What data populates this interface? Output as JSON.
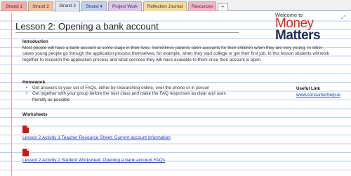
{
  "tabs": [
    {
      "label": "Strand 1",
      "color": "#f6a9a9"
    },
    {
      "label": "Strand 2",
      "color": "#f6c0a0"
    },
    {
      "label": "Strand 3",
      "color": "#dfe6f0"
    },
    {
      "label": "Strand 4",
      "color": "#c3cff0"
    },
    {
      "label": "Project Work",
      "color": "#dcc6ec"
    },
    {
      "label": "Reflection Journal",
      "color": "#f3dc9c"
    },
    {
      "label": "Resources",
      "color": "#f3b4c6"
    }
  ],
  "active_tab": "Strand 3",
  "add_tab_label": "+",
  "page": {
    "title": "Lesson 2: Opening a bank account",
    "expand_icon": "⤢"
  },
  "logo": {
    "welcome": "Welcome to",
    "money": "Money",
    "matters": "Matters"
  },
  "introduction": {
    "heading": "Introduction",
    "text": "Most people will have a bank account at some stage in their lives. Sometimes parents open accounts for their children when they are very young. In other cases young people go through the application process themselves, for example, when they start college or get their first job. In this lesson students will work together to research the application process and what services they will have available to them once their account is open."
  },
  "homework": {
    "heading": "Homework",
    "items": [
      "Get answers to your set of FAQs, either by researching online, over the phone or in person",
      "Get together with your group before the next class and make the FAQ responses as clear and user-friendly as possible"
    ]
  },
  "useful_link": {
    "heading": "Useful Link",
    "link": "www.consumerhelp.ie"
  },
  "worksheets": {
    "heading": "Worksheets",
    "items": [
      {
        "label": "Lesson 2 Activity 1 Teacher Resource Sheet: Current account information",
        "icon": "pdf-icon"
      },
      {
        "label": "Lesson 2 Activity 2 Student Worksheet: Opening a bank account FAQs",
        "icon": "pdf-icon"
      }
    ]
  }
}
